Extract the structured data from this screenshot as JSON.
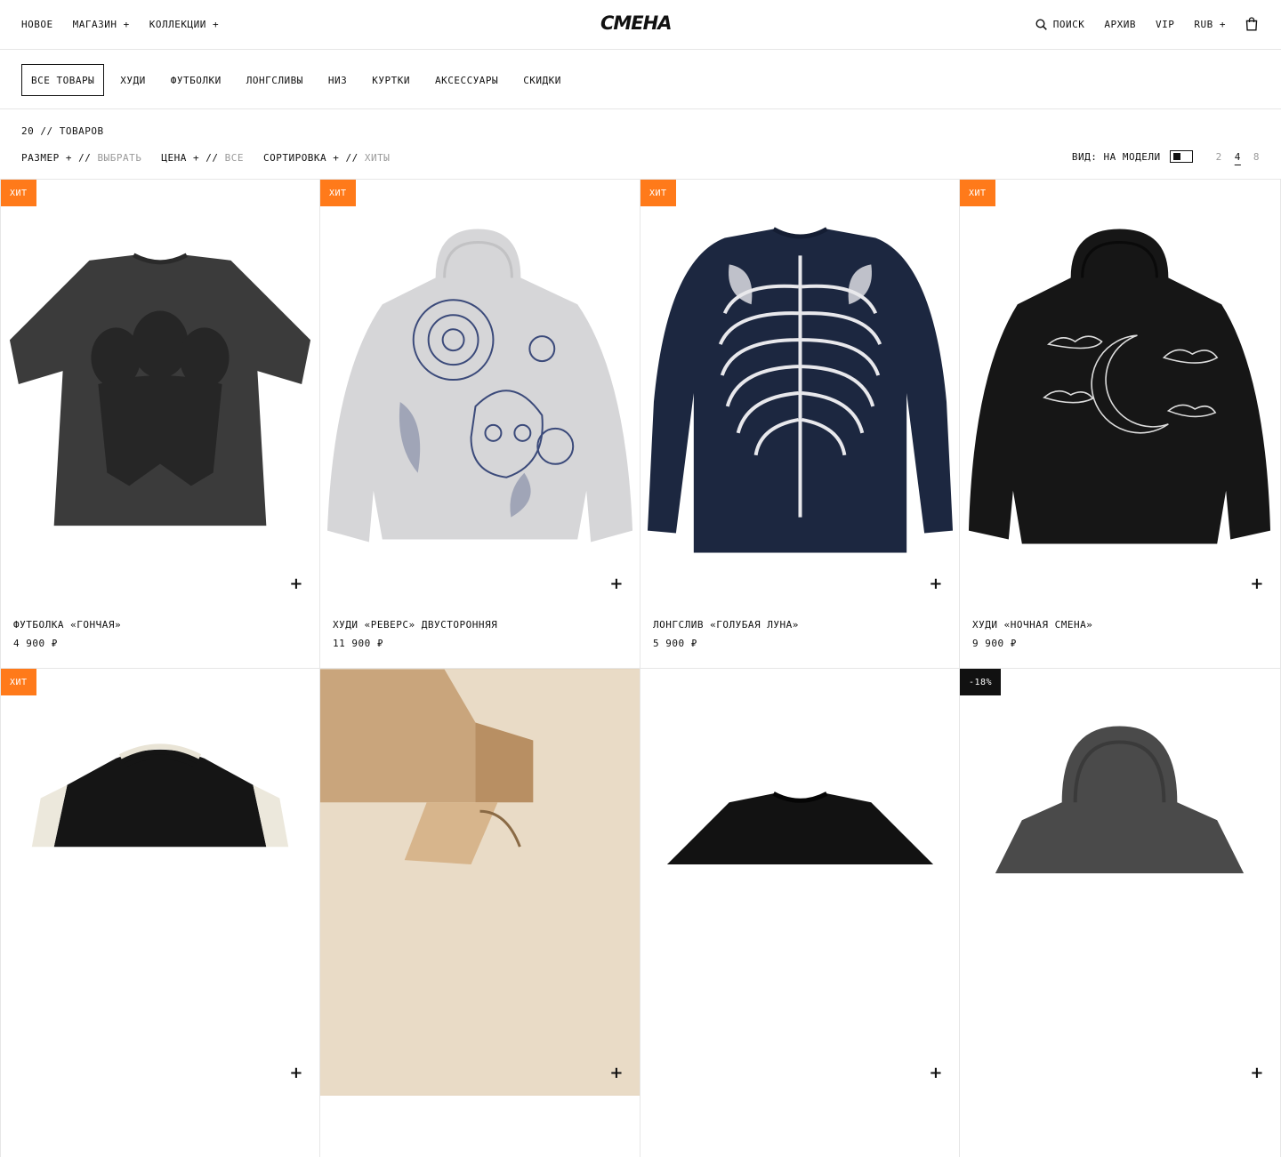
{
  "header": {
    "nav_left": [
      "НОВОЕ",
      "МАГАЗИН +",
      "КОЛЛЕКЦИИ +"
    ],
    "logo": "СМЕНА",
    "search_label": "ПОИСК",
    "archive": "АРХИВ",
    "vip": "VIP",
    "currency": "RUB +"
  },
  "categories": [
    "ВСЕ ТОВАРЫ",
    "ХУДИ",
    "ФУТБОЛКИ",
    "ЛОНГСЛИВЫ",
    "НИЗ",
    "КУРТКИ",
    "АКСЕССУАРЫ",
    "СКИДКИ"
  ],
  "listing": {
    "count": "20 // ТОВАРОВ",
    "filters": {
      "size_label": "РАЗМЕР + //",
      "size_value": "ВЫБРАТЬ",
      "price_label": "ЦЕНА + //",
      "price_value": "ВСЕ",
      "sort_label": "СОРТИРОВКА + //",
      "sort_value": "ХИТЫ"
    },
    "view_label": "ВИД: НА МОДЕЛИ",
    "columns": [
      "2",
      "4",
      "8"
    ],
    "active_columns": "4"
  },
  "products": [
    {
      "badge": "ХИТ",
      "title": "ФУТБОЛКА «ГОНЧАЯ»",
      "price": "4 900 ₽"
    },
    {
      "badge": "ХИТ",
      "title": "ХУДИ «РЕВЕРС» ДВУСТОРОННЯЯ",
      "price": "11 900 ₽"
    },
    {
      "badge": "ХИТ",
      "title": "ЛОНГСЛИВ «ГОЛУБАЯ ЛУНА»",
      "price": "5 900 ₽"
    },
    {
      "badge": "ХИТ",
      "title": "ХУДИ «НОЧНАЯ СМЕНА»",
      "price": "9 900 ₽"
    },
    {
      "badge": "ХИТ",
      "title": "",
      "price": ""
    },
    {
      "badge": "",
      "title": "",
      "price": ""
    },
    {
      "badge": "",
      "title": "",
      "price": ""
    },
    {
      "badge": "-18%",
      "title": "",
      "price": ""
    }
  ],
  "add_glyph": "+"
}
